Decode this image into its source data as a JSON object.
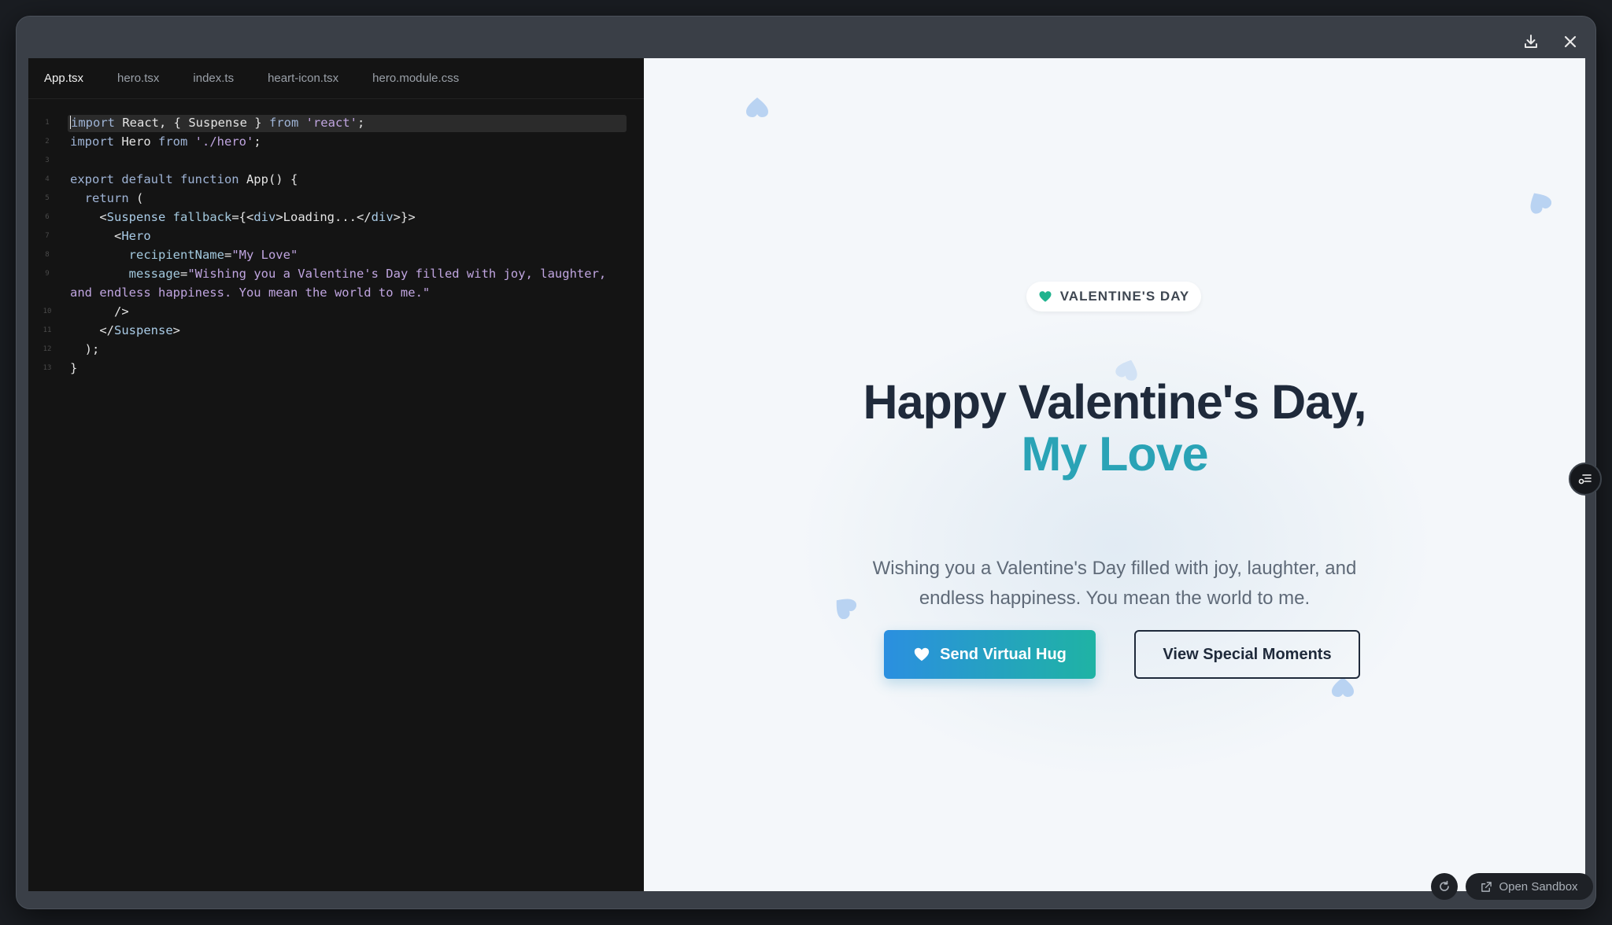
{
  "window": {
    "actions": {
      "download_icon": "download-icon",
      "close_icon": "close-icon"
    }
  },
  "editor": {
    "tabs": [
      {
        "label": "App.tsx",
        "active": true
      },
      {
        "label": "hero.tsx",
        "active": false
      },
      {
        "label": "index.ts",
        "active": false
      },
      {
        "label": "heart-icon.tsx",
        "active": false
      },
      {
        "label": "hero.module.css",
        "active": false
      }
    ],
    "lines": [
      {
        "n": "1",
        "a": "import",
        "b": " React, { Suspense } ",
        "c": "from",
        "d": " 'react'",
        "e": ";"
      },
      {
        "n": "2",
        "a": "import",
        "b": " Hero ",
        "c": "from",
        "d": " './hero'",
        "e": ";"
      },
      {
        "n": "3"
      },
      {
        "n": "4",
        "kw": "export default function",
        "rest": " App() {"
      },
      {
        "n": "5",
        "kw": "  return",
        "rest": " ("
      },
      {
        "n": "6",
        "pre": "    <",
        "tag": "Suspense",
        "attr": " fallback",
        "rest": "={<",
        "tag2": "div",
        "mid": ">Loading...</",
        "tag3": "div",
        "end": ">}>"
      },
      {
        "n": "7",
        "pre": "      <",
        "tag": "Hero"
      },
      {
        "n": "8",
        "attr": "        recipientName",
        "eq": "=",
        "str": "\"My Love\""
      },
      {
        "n": "9",
        "attr": "        message",
        "eq": "=",
        "str": "\"Wishing you a Valentine's Day filled with joy, laughter,",
        "str2": "and endless happiness. You mean the world to me.\""
      },
      {
        "n": "10",
        "txt": "      />"
      },
      {
        "n": "11",
        "pre": "    </",
        "tag": "Suspense",
        "end": ">"
      },
      {
        "n": "12",
        "txt": "  );"
      },
      {
        "n": "13",
        "txt": "}"
      }
    ]
  },
  "preview": {
    "badge": {
      "icon": "heart-icon",
      "text": "VALENTINE'S DAY"
    },
    "title_line1": "Happy Valentine's Day,",
    "title_line2": "My Love",
    "message": "Wishing you a Valentine's Day filled with joy, laughter, and endless happiness. You mean the world to me.",
    "primary_button": {
      "label": "Send Virtual Hug",
      "icon": "heart-icon"
    },
    "secondary_button": {
      "label": "View Special Moments"
    },
    "open_sandbox": "Open Sandbox"
  },
  "colors": {
    "accent": "#2aa3b6",
    "title": "#1f2a3b",
    "badge_heart": "#1fb38e",
    "deco_heart": "#b9d3f2",
    "button_gradient_start": "#2b8fe0",
    "button_gradient_end": "#1fb3a4"
  }
}
